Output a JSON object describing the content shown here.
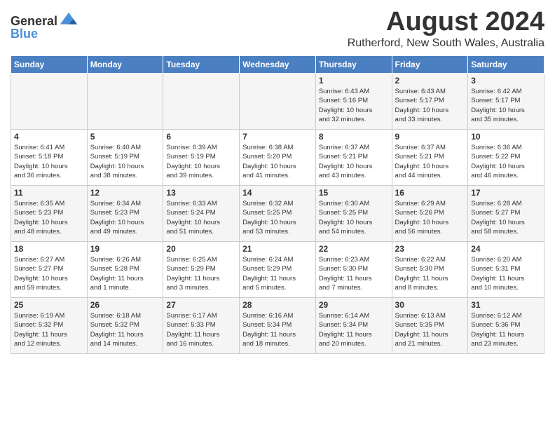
{
  "logo": {
    "general": "General",
    "blue": "Blue"
  },
  "title": {
    "month_year": "August 2024",
    "location": "Rutherford, New South Wales, Australia"
  },
  "days_of_week": [
    "Sunday",
    "Monday",
    "Tuesday",
    "Wednesday",
    "Thursday",
    "Friday",
    "Saturday"
  ],
  "weeks": [
    [
      {
        "day": "",
        "info": ""
      },
      {
        "day": "",
        "info": ""
      },
      {
        "day": "",
        "info": ""
      },
      {
        "day": "",
        "info": ""
      },
      {
        "day": "1",
        "info": "Sunrise: 6:43 AM\nSunset: 5:16 PM\nDaylight: 10 hours\nand 32 minutes."
      },
      {
        "day": "2",
        "info": "Sunrise: 6:43 AM\nSunset: 5:17 PM\nDaylight: 10 hours\nand 33 minutes."
      },
      {
        "day": "3",
        "info": "Sunrise: 6:42 AM\nSunset: 5:17 PM\nDaylight: 10 hours\nand 35 minutes."
      }
    ],
    [
      {
        "day": "4",
        "info": "Sunrise: 6:41 AM\nSunset: 5:18 PM\nDaylight: 10 hours\nand 36 minutes."
      },
      {
        "day": "5",
        "info": "Sunrise: 6:40 AM\nSunset: 5:19 PM\nDaylight: 10 hours\nand 38 minutes."
      },
      {
        "day": "6",
        "info": "Sunrise: 6:39 AM\nSunset: 5:19 PM\nDaylight: 10 hours\nand 39 minutes."
      },
      {
        "day": "7",
        "info": "Sunrise: 6:38 AM\nSunset: 5:20 PM\nDaylight: 10 hours\nand 41 minutes."
      },
      {
        "day": "8",
        "info": "Sunrise: 6:37 AM\nSunset: 5:21 PM\nDaylight: 10 hours\nand 43 minutes."
      },
      {
        "day": "9",
        "info": "Sunrise: 6:37 AM\nSunset: 5:21 PM\nDaylight: 10 hours\nand 44 minutes."
      },
      {
        "day": "10",
        "info": "Sunrise: 6:36 AM\nSunset: 5:22 PM\nDaylight: 10 hours\nand 46 minutes."
      }
    ],
    [
      {
        "day": "11",
        "info": "Sunrise: 6:35 AM\nSunset: 5:23 PM\nDaylight: 10 hours\nand 48 minutes."
      },
      {
        "day": "12",
        "info": "Sunrise: 6:34 AM\nSunset: 5:23 PM\nDaylight: 10 hours\nand 49 minutes."
      },
      {
        "day": "13",
        "info": "Sunrise: 6:33 AM\nSunset: 5:24 PM\nDaylight: 10 hours\nand 51 minutes."
      },
      {
        "day": "14",
        "info": "Sunrise: 6:32 AM\nSunset: 5:25 PM\nDaylight: 10 hours\nand 53 minutes."
      },
      {
        "day": "15",
        "info": "Sunrise: 6:30 AM\nSunset: 5:25 PM\nDaylight: 10 hours\nand 54 minutes."
      },
      {
        "day": "16",
        "info": "Sunrise: 6:29 AM\nSunset: 5:26 PM\nDaylight: 10 hours\nand 56 minutes."
      },
      {
        "day": "17",
        "info": "Sunrise: 6:28 AM\nSunset: 5:27 PM\nDaylight: 10 hours\nand 58 minutes."
      }
    ],
    [
      {
        "day": "18",
        "info": "Sunrise: 6:27 AM\nSunset: 5:27 PM\nDaylight: 10 hours\nand 59 minutes."
      },
      {
        "day": "19",
        "info": "Sunrise: 6:26 AM\nSunset: 5:28 PM\nDaylight: 11 hours\nand 1 minute."
      },
      {
        "day": "20",
        "info": "Sunrise: 6:25 AM\nSunset: 5:29 PM\nDaylight: 11 hours\nand 3 minutes."
      },
      {
        "day": "21",
        "info": "Sunrise: 6:24 AM\nSunset: 5:29 PM\nDaylight: 11 hours\nand 5 minutes."
      },
      {
        "day": "22",
        "info": "Sunrise: 6:23 AM\nSunset: 5:30 PM\nDaylight: 11 hours\nand 7 minutes."
      },
      {
        "day": "23",
        "info": "Sunrise: 6:22 AM\nSunset: 5:30 PM\nDaylight: 11 hours\nand 8 minutes."
      },
      {
        "day": "24",
        "info": "Sunrise: 6:20 AM\nSunset: 5:31 PM\nDaylight: 11 hours\nand 10 minutes."
      }
    ],
    [
      {
        "day": "25",
        "info": "Sunrise: 6:19 AM\nSunset: 5:32 PM\nDaylight: 11 hours\nand 12 minutes."
      },
      {
        "day": "26",
        "info": "Sunrise: 6:18 AM\nSunset: 5:32 PM\nDaylight: 11 hours\nand 14 minutes."
      },
      {
        "day": "27",
        "info": "Sunrise: 6:17 AM\nSunset: 5:33 PM\nDaylight: 11 hours\nand 16 minutes."
      },
      {
        "day": "28",
        "info": "Sunrise: 6:16 AM\nSunset: 5:34 PM\nDaylight: 11 hours\nand 18 minutes."
      },
      {
        "day": "29",
        "info": "Sunrise: 6:14 AM\nSunset: 5:34 PM\nDaylight: 11 hours\nand 20 minutes."
      },
      {
        "day": "30",
        "info": "Sunrise: 6:13 AM\nSunset: 5:35 PM\nDaylight: 11 hours\nand 21 minutes."
      },
      {
        "day": "31",
        "info": "Sunrise: 6:12 AM\nSunset: 5:36 PM\nDaylight: 11 hours\nand 23 minutes."
      }
    ]
  ]
}
